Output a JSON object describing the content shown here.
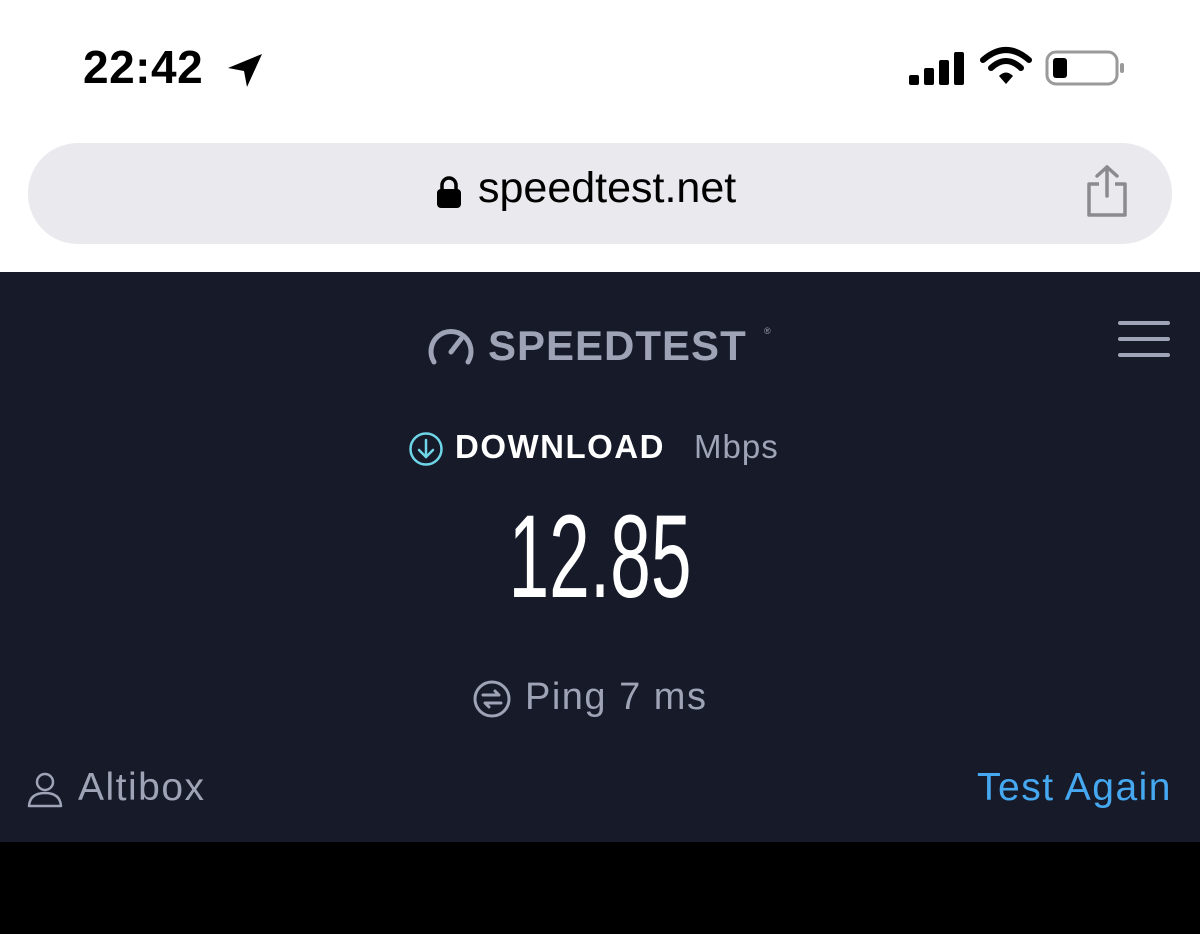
{
  "status_bar": {
    "time": "22:42",
    "icons": [
      "location-arrow-icon",
      "cellular-signal-icon",
      "wifi-icon",
      "battery-icon"
    ]
  },
  "browser": {
    "url": "speedtest.net",
    "icons": [
      "lock-icon",
      "share-icon"
    ]
  },
  "speedtest": {
    "logo_text": "SPEEDTEST",
    "logo_mark": "®",
    "download_label": "DOWNLOAD",
    "download_unit": "Mbps",
    "download_value": "12.85",
    "ping_text": "Ping 7 ms",
    "provider": "Altibox",
    "test_again": "Test Again"
  },
  "colors": {
    "panel_background": "#161a29",
    "accent_link": "#45a8f0",
    "download_icon": "#6fd6e8",
    "muted_text": "#9ea3b6"
  }
}
